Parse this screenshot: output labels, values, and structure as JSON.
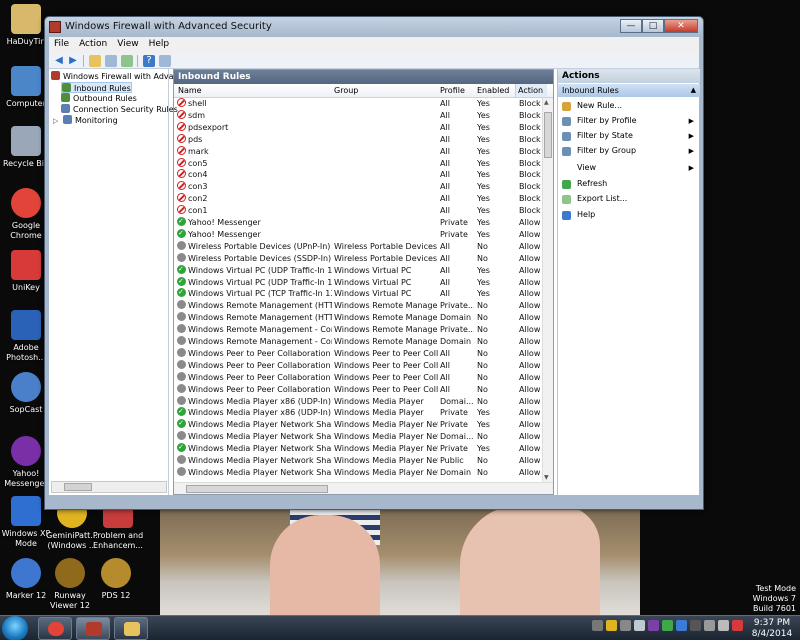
{
  "window": {
    "title": "Windows Firewall with Advanced Security",
    "menu": [
      "File",
      "Action",
      "View",
      "Help"
    ]
  },
  "tree": {
    "root": "Windows Firewall with Advanced",
    "items": [
      "Inbound Rules",
      "Outbound Rules",
      "Connection Security Rules",
      "Monitoring"
    ],
    "selected": "Inbound Rules"
  },
  "rules_pane": {
    "title": "Inbound Rules",
    "columns": [
      "Name",
      "Group",
      "Profile",
      "Enabled",
      "Action"
    ],
    "rows": [
      {
        "icon": "block",
        "name": "shell",
        "group": "",
        "profile": "All",
        "enabled": "Yes",
        "action": "Block"
      },
      {
        "icon": "block",
        "name": "sdm",
        "group": "",
        "profile": "All",
        "enabled": "Yes",
        "action": "Block"
      },
      {
        "icon": "block",
        "name": "pdsexport",
        "group": "",
        "profile": "All",
        "enabled": "Yes",
        "action": "Block"
      },
      {
        "icon": "block",
        "name": "pds",
        "group": "",
        "profile": "All",
        "enabled": "Yes",
        "action": "Block"
      },
      {
        "icon": "block",
        "name": "mark",
        "group": "",
        "profile": "All",
        "enabled": "Yes",
        "action": "Block"
      },
      {
        "icon": "block",
        "name": "con5",
        "group": "",
        "profile": "All",
        "enabled": "Yes",
        "action": "Block"
      },
      {
        "icon": "block",
        "name": "con4",
        "group": "",
        "profile": "All",
        "enabled": "Yes",
        "action": "Block"
      },
      {
        "icon": "block",
        "name": "con3",
        "group": "",
        "profile": "All",
        "enabled": "Yes",
        "action": "Block"
      },
      {
        "icon": "block",
        "name": "con2",
        "group": "",
        "profile": "All",
        "enabled": "Yes",
        "action": "Block"
      },
      {
        "icon": "block",
        "name": "con1",
        "group": "",
        "profile": "All",
        "enabled": "Yes",
        "action": "Block"
      },
      {
        "icon": "allow",
        "name": "Yahoo! Messenger",
        "group": "",
        "profile": "Private",
        "enabled": "Yes",
        "action": "Allow"
      },
      {
        "icon": "allow",
        "name": "Yahoo! Messenger",
        "group": "",
        "profile": "Private",
        "enabled": "Yes",
        "action": "Allow"
      },
      {
        "icon": "dis",
        "name": "Wireless Portable Devices (UPnP-In)",
        "group": "Wireless Portable Devices",
        "profile": "All",
        "enabled": "No",
        "action": "Allow"
      },
      {
        "icon": "dis",
        "name": "Wireless Portable Devices (SSDP-In)",
        "group": "Wireless Portable Devices",
        "profile": "All",
        "enabled": "No",
        "action": "Allow"
      },
      {
        "icon": "allow",
        "name": "Windows Virtual PC (UDP Traffic-In 138)",
        "group": "Windows Virtual PC",
        "profile": "All",
        "enabled": "Yes",
        "action": "Allow"
      },
      {
        "icon": "allow",
        "name": "Windows Virtual PC (UDP Traffic-In 137)",
        "group": "Windows Virtual PC",
        "profile": "All",
        "enabled": "Yes",
        "action": "Allow"
      },
      {
        "icon": "allow",
        "name": "Windows Virtual PC (TCP Traffic-In 139)",
        "group": "Windows Virtual PC",
        "profile": "All",
        "enabled": "Yes",
        "action": "Allow"
      },
      {
        "icon": "dis",
        "name": "Windows Remote Management (HTTP-In)",
        "group": "Windows Remote Manage...",
        "profile": "Private...",
        "enabled": "No",
        "action": "Allow"
      },
      {
        "icon": "dis",
        "name": "Windows Remote Management (HTTP-In)",
        "group": "Windows Remote Manage...",
        "profile": "Domain",
        "enabled": "No",
        "action": "Allow"
      },
      {
        "icon": "dis",
        "name": "Windows Remote Management - Compa...",
        "group": "Windows Remote Manage...",
        "profile": "Private...",
        "enabled": "No",
        "action": "Allow"
      },
      {
        "icon": "dis",
        "name": "Windows Remote Management - Compa...",
        "group": "Windows Remote Manage...",
        "profile": "Domain",
        "enabled": "No",
        "action": "Allow"
      },
      {
        "icon": "dis",
        "name": "Windows Peer to Peer Collaboration Fou...",
        "group": "Windows Peer to Peer Colla...",
        "profile": "All",
        "enabled": "No",
        "action": "Allow"
      },
      {
        "icon": "dis",
        "name": "Windows Peer to Peer Collaboration Fou...",
        "group": "Windows Peer to Peer Colla...",
        "profile": "All",
        "enabled": "No",
        "action": "Allow"
      },
      {
        "icon": "dis",
        "name": "Windows Peer to Peer Collaboration Fou...",
        "group": "Windows Peer to Peer Colla...",
        "profile": "All",
        "enabled": "No",
        "action": "Allow"
      },
      {
        "icon": "dis",
        "name": "Windows Peer to Peer Collaboration Fou...",
        "group": "Windows Peer to Peer Colla...",
        "profile": "All",
        "enabled": "No",
        "action": "Allow"
      },
      {
        "icon": "dis",
        "name": "Windows Media Player x86 (UDP-In)",
        "group": "Windows Media Player",
        "profile": "Domai...",
        "enabled": "No",
        "action": "Allow"
      },
      {
        "icon": "allow",
        "name": "Windows Media Player x86 (UDP-In)",
        "group": "Windows Media Player",
        "profile": "Private",
        "enabled": "Yes",
        "action": "Allow"
      },
      {
        "icon": "allow",
        "name": "Windows Media Player Network Sharing ...",
        "group": "Windows Media Player Net...",
        "profile": "Private",
        "enabled": "Yes",
        "action": "Allow"
      },
      {
        "icon": "dis",
        "name": "Windows Media Player Network Sharing ...",
        "group": "Windows Media Player Net...",
        "profile": "Domai...",
        "enabled": "No",
        "action": "Allow"
      },
      {
        "icon": "allow",
        "name": "Windows Media Player Network Sharing ...",
        "group": "Windows Media Player Net...",
        "profile": "Private",
        "enabled": "Yes",
        "action": "Allow"
      },
      {
        "icon": "dis",
        "name": "Windows Media Player Network Sharing ...",
        "group": "Windows Media Player Net...",
        "profile": "Public",
        "enabled": "No",
        "action": "Allow"
      },
      {
        "icon": "dis",
        "name": "Windows Media Player Network Sharing ...",
        "group": "Windows Media Player Net...",
        "profile": "Domain",
        "enabled": "No",
        "action": "Allow"
      }
    ]
  },
  "actions_pane": {
    "title": "Actions",
    "section": "Inbound Rules",
    "items": [
      {
        "label": "New Rule...",
        "submenu": false,
        "icon": "new-rule-icon"
      },
      {
        "label": "Filter by Profile",
        "submenu": true,
        "icon": "filter-icon"
      },
      {
        "label": "Filter by State",
        "submenu": true,
        "icon": "filter-icon"
      },
      {
        "label": "Filter by Group",
        "submenu": true,
        "icon": "filter-icon"
      },
      {
        "label": "View",
        "submenu": true,
        "icon": "none"
      },
      {
        "label": "Refresh",
        "submenu": false,
        "icon": "refresh-icon"
      },
      {
        "label": "Export List...",
        "submenu": false,
        "icon": "export-icon"
      },
      {
        "label": "Help",
        "submenu": false,
        "icon": "help-icon"
      }
    ]
  },
  "desktop": {
    "icons": [
      {
        "label": "HaDuyTin",
        "color": "#d8b86a"
      },
      {
        "label": "Computer",
        "color": "#4b86c8"
      },
      {
        "label": "Recycle Bin",
        "color": "#9aa7b8"
      },
      {
        "label": "Google Chrome",
        "color": "#e2443a"
      },
      {
        "label": "UniKey",
        "color": "#d83a3a"
      },
      {
        "label": "Adobe Photosh...",
        "color": "#2a62b8"
      },
      {
        "label": "SopCast",
        "color": "#4a7fc9"
      },
      {
        "label": "Yahoo! Messenger",
        "color": "#7a2fa8"
      },
      {
        "label": "Windows XP Mode",
        "color": "#2e6fd1"
      },
      {
        "label": "GeminiPatt... (Windows ...",
        "color": "#e0b421"
      },
      {
        "label": "Problem and Enhancem...",
        "color": "#c83c3c"
      },
      {
        "label": "Marker 12",
        "color": "#3f76d0"
      },
      {
        "label": "Runway Viewer 12",
        "color": "#8f6a1c"
      },
      {
        "label": "PDS 12",
        "color": "#b58b2d"
      }
    ]
  },
  "watermark": {
    "line1": "Test Mode",
    "line2": "Windows 7",
    "line3": "Build 7601"
  },
  "clock": {
    "time": "9:37 PM",
    "date": "8/4/2014"
  }
}
